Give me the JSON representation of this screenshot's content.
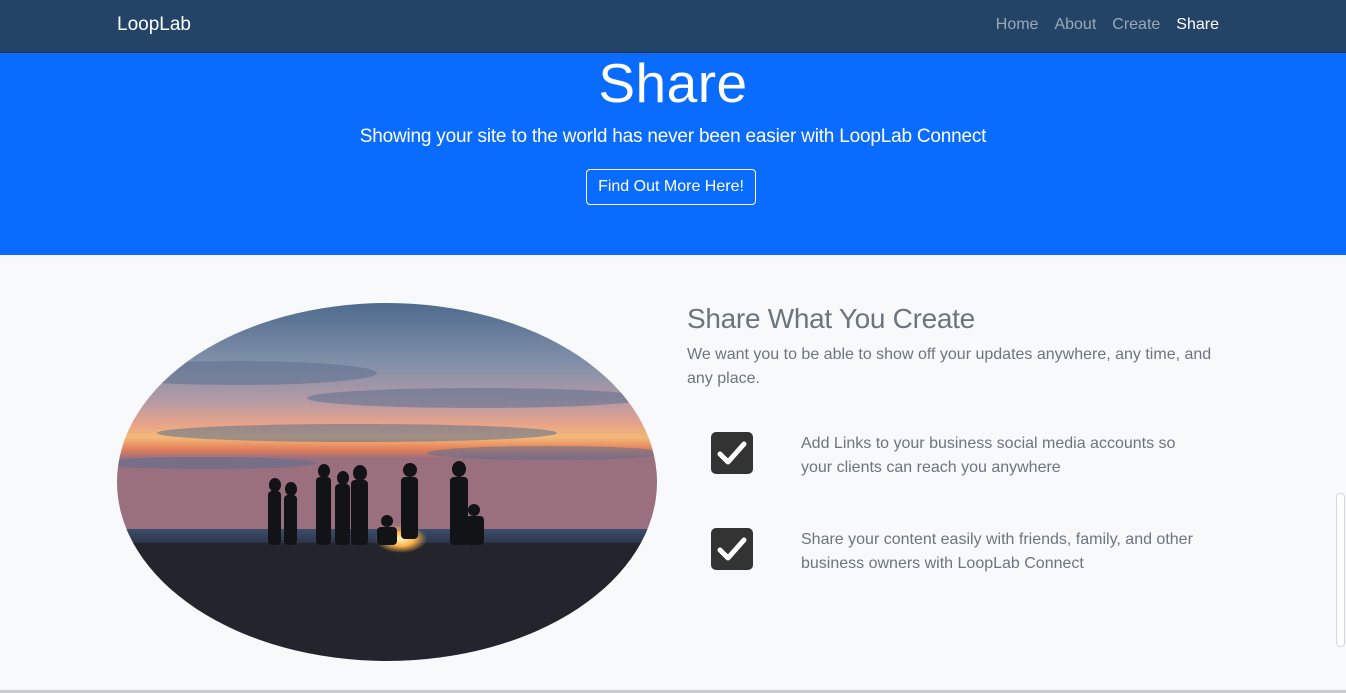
{
  "navbar": {
    "brand": "LoopLab",
    "links": [
      {
        "label": "Home",
        "active": false
      },
      {
        "label": "About",
        "active": false
      },
      {
        "label": "Create",
        "active": false
      },
      {
        "label": "Share",
        "active": true
      }
    ]
  },
  "hero": {
    "title": "Share",
    "subtitle": "Showing your site to the world has never been easier with LoopLab Connect",
    "cta_label": "Find Out More Here!",
    "background": "#0a6cff"
  },
  "section": {
    "heading": "Share What You Create",
    "lead": "We want you to be able to show off your updates anywhere, any time, and any place.",
    "features": [
      {
        "icon": "checkbox-checked-icon",
        "text": "Add Links to your business social media accounts so your clients can reach you anywhere"
      },
      {
        "icon": "checkbox-checked-icon",
        "text": "Share your content easily with friends, family, and other business owners with LoopLab Connect"
      }
    ]
  },
  "colors": {
    "navbar": "#234466",
    "hero": "#0a6cff",
    "muted_text": "#6c757d",
    "section_bg": "#f8f9fa"
  }
}
